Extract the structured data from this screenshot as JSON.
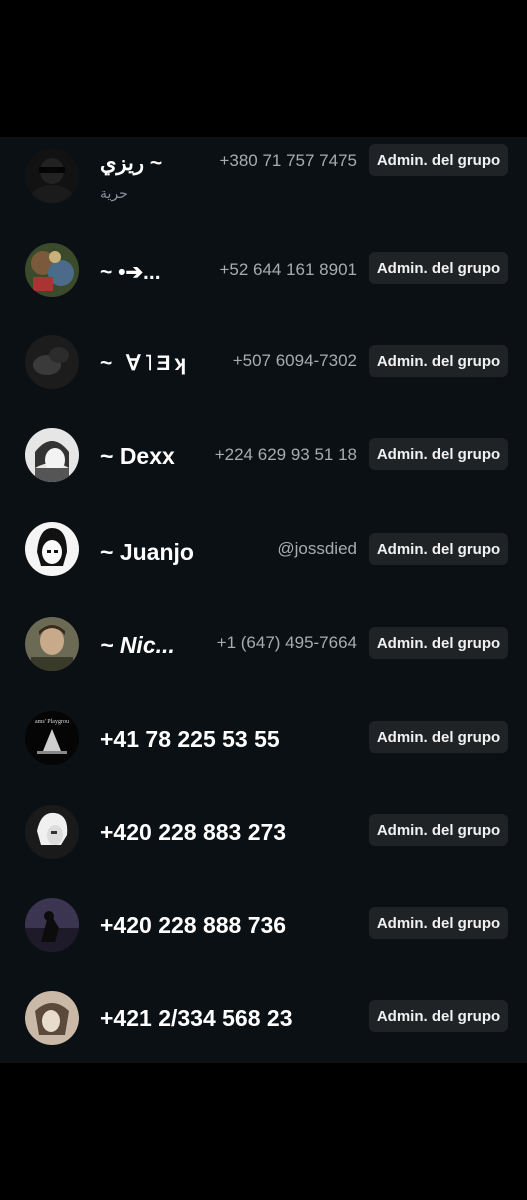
{
  "participants": [
    {
      "name": "~ ريزي",
      "status": "حرية",
      "contact": "+380 71 757 7475",
      "badge": "Admin. del grupo",
      "avatar": "avatar-dark-figure"
    },
    {
      "name": "~ •➔...",
      "contact": "+52 644 161 8901",
      "badge": "Admin. del grupo",
      "avatar": "avatar-colorful-art"
    },
    {
      "name": "~ ∀˥Ǝʞ",
      "contact": "+507 6094-7302",
      "badge": "Admin. del grupo",
      "avatar": "avatar-dark-hand"
    },
    {
      "name": "~ Dexx",
      "contact": "+224 629 93 51 18",
      "badge": "Admin. del grupo",
      "avatar": "avatar-anime-boy"
    },
    {
      "name": "~ Juanjo",
      "contact": "@jossdied",
      "badge": "Admin. del grupo",
      "avatar": "avatar-anime-girl"
    },
    {
      "name": "~ Nic...",
      "contact": "+1 (647) 495-7664",
      "badge": "Admin. del grupo",
      "avatar": "avatar-man-photo"
    },
    {
      "name": "+41 78 225 53 55",
      "contact": "",
      "badge": "Admin. del grupo",
      "avatar": "avatar-playground-logo",
      "avatar_text": "ams' Playgrou"
    },
    {
      "name": "+420 228 883 273",
      "contact": "",
      "badge": "Admin. del grupo",
      "avatar": "avatar-white-hair"
    },
    {
      "name": "+420 228 888 736",
      "contact": "",
      "badge": "Admin. del grupo",
      "avatar": "avatar-purple-silhouette"
    },
    {
      "name": "+421 2/334 568 23",
      "contact": "",
      "badge": "Admin. del grupo",
      "avatar": "avatar-beige-sketch"
    }
  ]
}
